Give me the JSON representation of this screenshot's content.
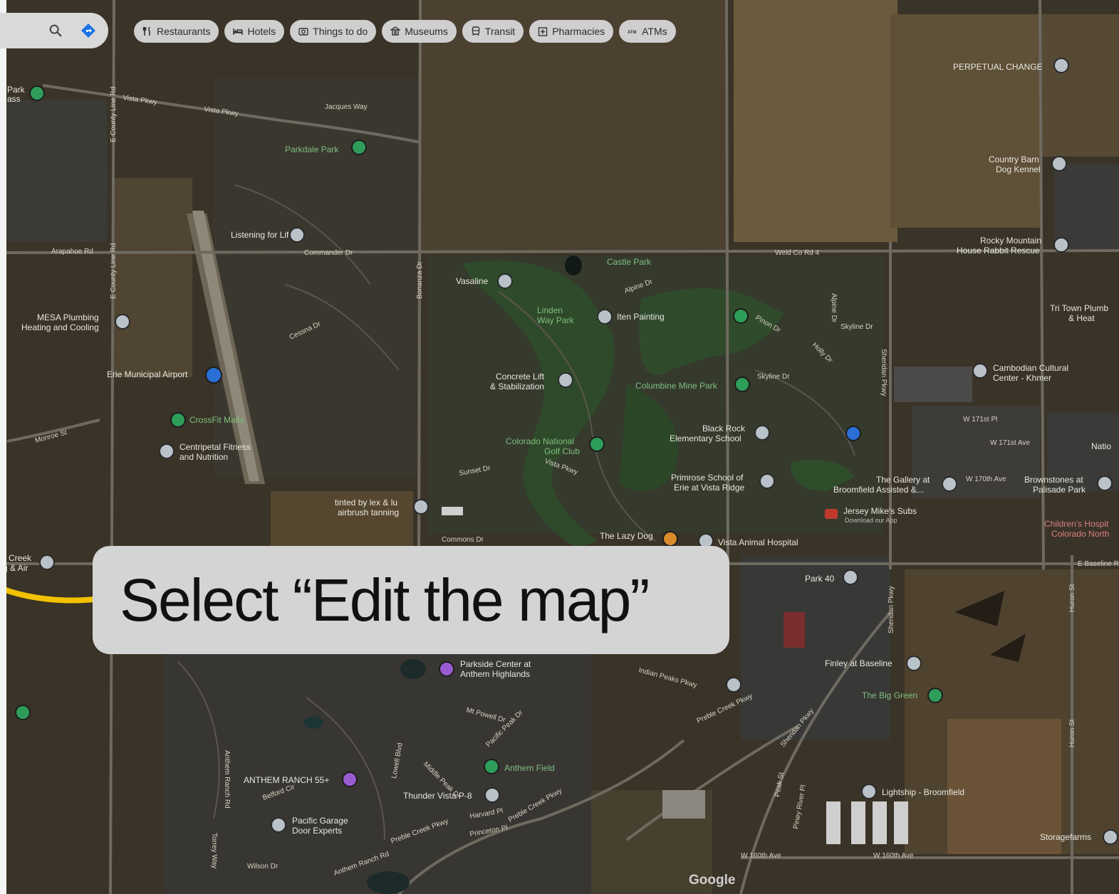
{
  "search": {
    "search_icon": "search-icon",
    "directions_icon": "directions-icon"
  },
  "chips": [
    {
      "label": "Restaurants",
      "icon": "fork-knife-icon"
    },
    {
      "label": "Hotels",
      "icon": "bed-icon"
    },
    {
      "label": "Things to do",
      "icon": "camera-icon"
    },
    {
      "label": "Museums",
      "icon": "museum-icon"
    },
    {
      "label": "Transit",
      "icon": "train-icon"
    },
    {
      "label": "Pharmacies",
      "icon": "pharmacy-icon"
    },
    {
      "label": "ATMs",
      "icon": "atm-icon"
    }
  ],
  "callout": {
    "text": "Select “Edit the map”"
  },
  "map": {
    "attribution": "Google",
    "places": [
      "PERPETUAL CHANGE",
      "Country Barn Dog Kennel",
      "Rocky Mountain House Rabbit Rescue",
      "Parkdale Park",
      "Listening for Life",
      "Vasaline",
      "Castle Park",
      "Iten Painting",
      "Linden Way Park",
      "MESA Plumbing Heating and Cooling",
      "Erie Municipal Airport",
      "CrossFit Mafia",
      "Centripetal Fitness and Nutrition",
      "Concrete Lift & Stabilization",
      "Columbine Mine Park",
      "Colorado National Golf Club",
      "Black Rock Elementary School",
      "Primrose School of Erie at Vista Ridge",
      "The Gallery at Broomfield Assisted &...",
      "Cambodian Cultural Center - Khmer",
      "Tri Town Plumb & Heat",
      "Brownstones at Palisade Park",
      "Jersey Mike's Subs",
      "Download our App",
      "tinted by lex & lu airbrush tanning",
      "The Lazy Dog",
      "Vista Animal Hospital",
      "Park 40",
      "Finley at Baseline",
      "The Big Green",
      "Parkside Center at Anthem Highlands",
      "ANTHEM RANCH 55+",
      "Anthem Field",
      "Thunder Vista P-8",
      "Pacific Garage Door Experts",
      "Lightship - Broomfield",
      "Storagefarms",
      "Children's Hospit Colorado North",
      "Natio",
      "Park Pass",
      "Creek Golf & Air"
    ],
    "roads": [
      "Vista Pkwy",
      "Jacques Way",
      "E County Line Rd",
      "Arapahoe Rd",
      "Commander Dr",
      "Cessna Dr",
      "Monroe St",
      "Bonanza Dr",
      "Weld Co Rd 4",
      "Alpine Dr",
      "Pinon Dr",
      "Skyline Dr",
      "Holly Dr",
      "Sheridan Pkwy",
      "W 171st Pl",
      "W 171st Ave",
      "W 170th Ave",
      "Sunset Dr",
      "Commons Dr",
      "E Baseline Rd",
      "Huron St",
      "Indian Peaks Pkwy",
      "Preble Creek Pkwy",
      "Mt Powell Dr",
      "Pacific Peak Dr",
      "Middle Peak Dr",
      "Lowell Blvd",
      "Anthem Ranch Rd",
      "Harvard Pl",
      "Princeton Pl",
      "W 160th Ave",
      "Wilson Dr",
      "Torrey Way",
      "Belford Cir",
      "Sheridan Pkwy",
      "Peak St",
      "Piney River Pl"
    ]
  },
  "colors": {
    "chip_bg": "#cfcfcf",
    "callout_bg": "#d4d4d4",
    "accent_yellow": "#f2c200",
    "pin_gray": "#b9c2c9",
    "pin_green": "#2e9d5a",
    "pin_blue": "#2a6fd6",
    "pin_purple": "#9a5bd1"
  }
}
